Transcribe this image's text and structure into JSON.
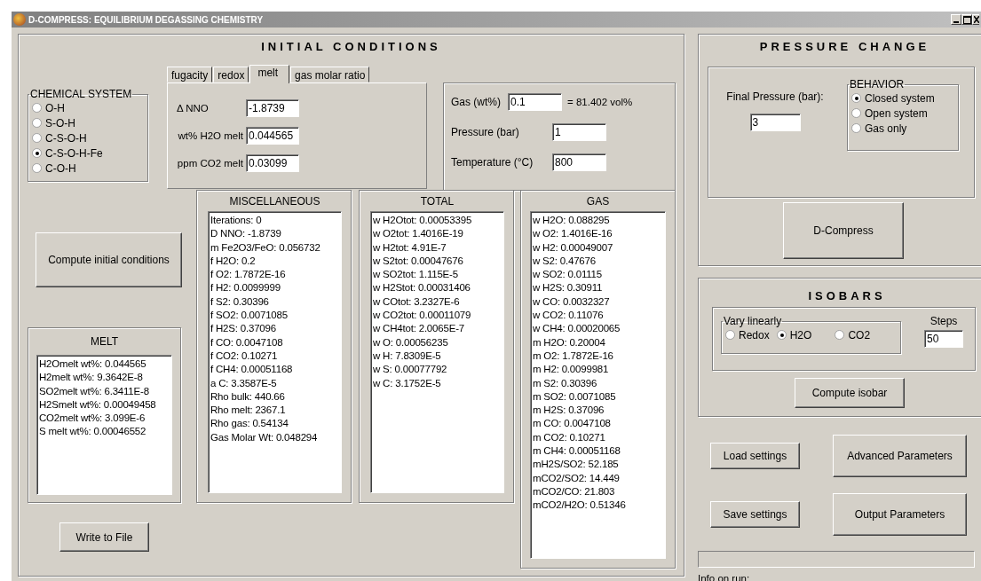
{
  "window": {
    "title": "D-COMPRESS: EQUILIBRIUM DEGASSING CHEMISTRY"
  },
  "initial_conditions": {
    "title": "INITIAL CONDITIONS",
    "chemical_system": {
      "label": "CHEMICAL SYSTEM",
      "options": [
        {
          "label": "O-H",
          "selected": false
        },
        {
          "label": "S-O-H",
          "selected": false
        },
        {
          "label": "C-S-O-H",
          "selected": false
        },
        {
          "label": "C-S-O-H-Fe",
          "selected": true
        },
        {
          "label": "C-O-H",
          "selected": false
        }
      ]
    },
    "tabs": [
      {
        "label": "fugacity",
        "selected": false
      },
      {
        "label": "redox",
        "selected": false
      },
      {
        "label": "melt",
        "selected": true
      },
      {
        "label": "gas molar ratio",
        "selected": false
      }
    ],
    "tab_fields": [
      {
        "label": "Δ NNO",
        "value": "-1.8739"
      },
      {
        "label": "wt% H2O melt",
        "value": "0.044565"
      },
      {
        "label": "ppm CO2 melt",
        "value": "0.03099"
      }
    ],
    "gas_fields": [
      {
        "label": "Gas (wt%)",
        "value": "0.1",
        "note": "= 81.402 vol%"
      },
      {
        "label": "Pressure (bar)",
        "value": "1"
      },
      {
        "label": "Temperature (°C)",
        "value": "800"
      }
    ],
    "compute_button": "Compute initial conditions",
    "melt": {
      "title": "MELT",
      "lines": [
        "H2Omelt wt%: 0.044565",
        "H2melt wt%: 9.3642E-8",
        "SO2melt wt%: 6.3411E-8",
        "H2Smelt wt%: 0.00049458",
        "CO2melt wt%: 3.099E-6",
        "S melt wt%: 0.00046552"
      ]
    },
    "miscellaneous": {
      "title": "MISCELLANEOUS",
      "lines": [
        "Iterations: 0",
        "D NNO: -1.8739",
        "m Fe2O3/FeO: 0.056732",
        "f H2O: 0.2",
        "f O2: 1.7872E-16",
        "f H2: 0.0099999",
        "f S2: 0.30396",
        "f SO2: 0.0071085",
        "f H2S: 0.37096",
        "f CO: 0.0047108",
        "f CO2: 0.10271",
        "f CH4: 0.00051168",
        "a C: 3.3587E-5",
        "Rho bulk: 440.66",
        "Rho melt: 2367.1",
        "Rho gas: 0.54134",
        "Gas Molar Wt: 0.048294"
      ]
    },
    "total": {
      "title": "TOTAL",
      "lines": [
        "w H2Otot: 0.00053395",
        "w O2tot: 1.4016E-19",
        "w H2tot: 4.91E-7",
        "w S2tot: 0.00047676",
        "w SO2tot: 1.115E-5",
        "w H2Stot: 0.00031406",
        "w COtot: 3.2327E-6",
        "w CO2tot: 0.00011079",
        "w CH4tot: 2.0065E-7",
        "w O: 0.00056235",
        "w H: 7.8309E-5",
        "w S: 0.00077792",
        "w C: 3.1752E-5"
      ]
    },
    "gas": {
      "title": "GAS",
      "lines": [
        "w H2O: 0.088295",
        "w O2: 1.4016E-16",
        "w H2: 0.00049007",
        "w S2: 0.47676",
        "w SO2: 0.01115",
        "w H2S: 0.30911",
        "w CO: 0.0032327",
        "w CO2: 0.11076",
        "w CH4: 0.00020065",
        "m H2O: 0.20004",
        "m O2: 1.7872E-16",
        "m H2: 0.0099981",
        "m S2: 0.30396",
        "m SO2: 0.0071085",
        "m H2S: 0.37096",
        "m CO: 0.0047108",
        "m CO2: 0.10271",
        "m CH4: 0.00051168",
        "mH2S/SO2: 52.185",
        "mCO2/SO2: 14.449",
        "mCO2/CO: 21.803",
        "mCO2/H2O: 0.51346"
      ]
    },
    "write_button": "Write to File"
  },
  "pressure_change": {
    "title": "PRESSURE CHANGE",
    "final_pressure_label": "Final Pressure (bar):",
    "final_pressure_value": "3",
    "behavior": {
      "label": "BEHAVIOR",
      "options": [
        {
          "label": "Closed system",
          "selected": true
        },
        {
          "label": "Open system",
          "selected": false
        },
        {
          "label": "Gas only",
          "selected": false
        }
      ]
    },
    "button": "D-Compress"
  },
  "isobars": {
    "title": "ISOBARS",
    "vary": {
      "label": "Vary linearly",
      "options": [
        {
          "label": "Redox",
          "selected": false
        },
        {
          "label": "H2O",
          "selected": true
        },
        {
          "label": "CO2",
          "selected": false
        }
      ]
    },
    "steps_label": "Steps",
    "steps_value": "50",
    "button": "Compute isobar"
  },
  "settings_buttons": [
    "Load settings",
    "Advanced Parameters",
    "Save settings",
    "Output Parameters"
  ],
  "progress": {
    "level": 0
  },
  "info_label": "Info on run:"
}
